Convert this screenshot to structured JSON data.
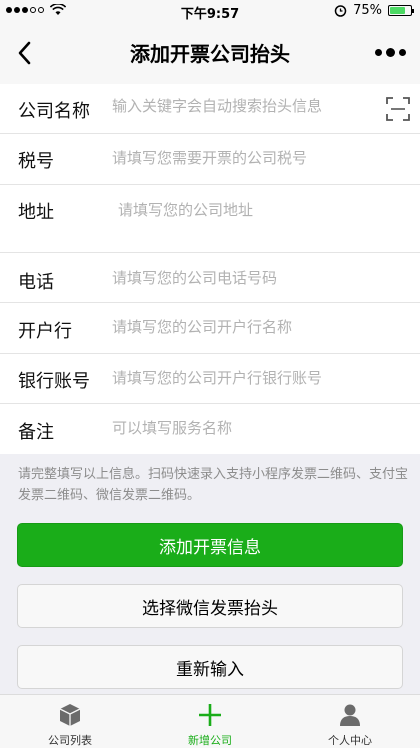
{
  "status_bar": {
    "time": "下午9:57",
    "battery": "75%",
    "battery_level": 0.75
  },
  "nav": {
    "title": "添加开票公司抬头",
    "back_icon": "chevron-left-icon",
    "more_icon": "more-icon"
  },
  "form": {
    "fields": [
      {
        "label": "公司名称",
        "placeholder": "输入关键字会自动搜索抬头信息"
      },
      {
        "label": "税号",
        "placeholder": "请填写您需要开票的公司税号"
      },
      {
        "label": "地址",
        "placeholder": "请填写您的公司地址"
      },
      {
        "label": "电话",
        "placeholder": "请填写您的公司电话号码"
      },
      {
        "label": "开户行",
        "placeholder": "请填写您的公司开户行名称"
      },
      {
        "label": "银行账号",
        "placeholder": "请填写您的公司开户行银行账号"
      },
      {
        "label": "备注",
        "placeholder": "可以填写服务名称"
      }
    ],
    "hint": "请完整填写以上信息。扫码快速录入支持小程序发票二维码、支付宝发票二维码、微信发票二维码。"
  },
  "buttons": {
    "add": "添加开票信息",
    "wechat": "选择微信发票抬头",
    "reset": "重新输入"
  },
  "tabbar": {
    "items": [
      {
        "label": "公司列表",
        "icon": "cube-icon"
      },
      {
        "label": "新增公司",
        "icon": "plus-icon"
      },
      {
        "label": "个人中心",
        "icon": "person-icon"
      }
    ],
    "active_index": 1,
    "accent": "#1aad19"
  }
}
